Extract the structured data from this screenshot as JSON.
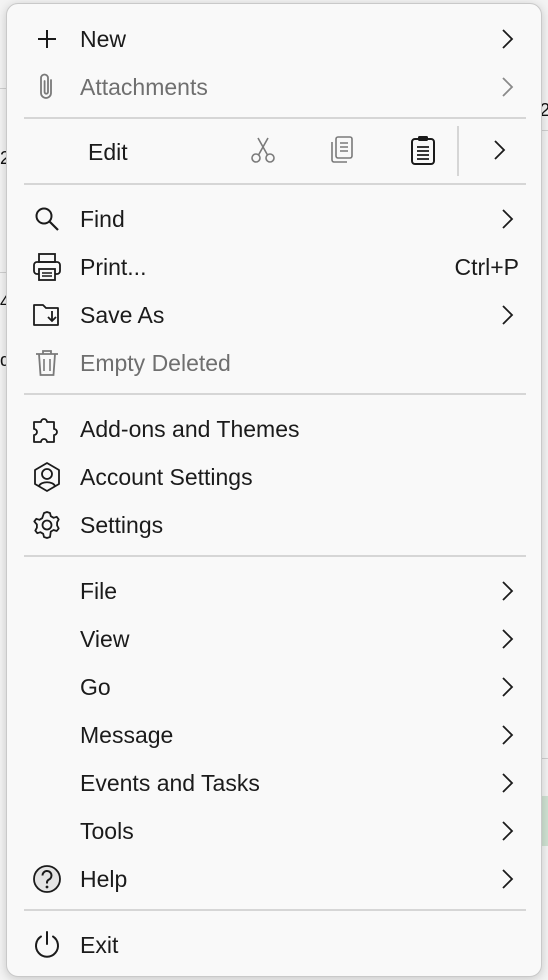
{
  "menu": {
    "new": {
      "label": "New"
    },
    "attachments": {
      "label": "Attachments"
    },
    "edit": {
      "label": "Edit"
    },
    "find": {
      "label": "Find"
    },
    "print": {
      "label": "Print...",
      "shortcut": "Ctrl+P"
    },
    "save_as": {
      "label": "Save As"
    },
    "empty_deleted": {
      "label": "Empty Deleted"
    },
    "addons": {
      "label": "Add-ons and Themes"
    },
    "account_settings": {
      "label": "Account Settings"
    },
    "settings": {
      "label": "Settings"
    },
    "file": {
      "label": "File"
    },
    "view": {
      "label": "View"
    },
    "go": {
      "label": "Go"
    },
    "message": {
      "label": "Message"
    },
    "events_tasks": {
      "label": "Events and Tasks"
    },
    "tools": {
      "label": "Tools"
    },
    "help": {
      "label": "Help"
    },
    "exit": {
      "label": "Exit"
    }
  },
  "background": {
    "frag1": "2",
    "frag2": "4",
    "frag3": "d",
    "frag4": "2"
  },
  "icons": {
    "new": "plus-icon",
    "attachments": "paperclip-icon",
    "cut": "scissors-icon",
    "copy": "copy-icon",
    "paste": "clipboard-icon",
    "find": "search-icon",
    "print": "printer-icon",
    "save_as": "folder-save-icon",
    "empty_deleted": "trash-icon",
    "addons": "puzzle-icon",
    "account_settings": "account-icon",
    "settings": "gear-icon",
    "help": "help-icon",
    "exit": "power-icon"
  },
  "colors": {
    "text": "#1b1b1b",
    "disabled": "#6f6f6f",
    "menu_bg": "#f9f9f9",
    "separator": "#d6d6d6"
  }
}
